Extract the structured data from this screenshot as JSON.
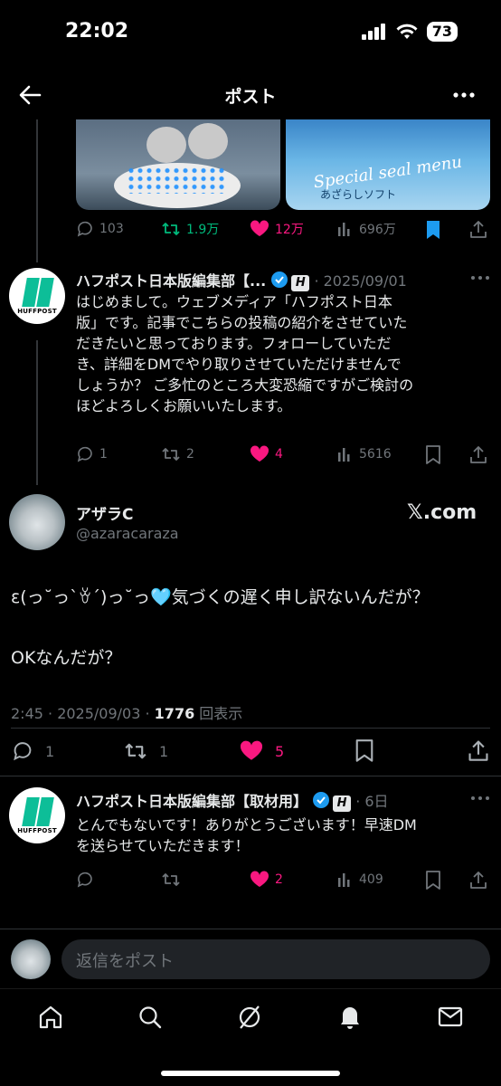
{
  "status_bar": {
    "time": "22:02",
    "battery": "73"
  },
  "header": {
    "title": "ポスト"
  },
  "images": {
    "special_text": "Special seal menu",
    "soft_text": "あざらしソフト"
  },
  "top_tweet_actions": {
    "replies": "103",
    "reposts": "1.9万",
    "likes": "12万",
    "views": "696万"
  },
  "reply1": {
    "name": "ハフポスト日本版編集部【...",
    "date": "· 2025/09/01",
    "avatar_text": "HUFFPOST",
    "badge": "H",
    "lines": [
      "はじめまして。ウェブメディア「ハフポスト日本",
      "版」です。記事でこちらの投稿の紹介をさせていた",
      "だきたいと思っております。フォローしていただ",
      "き、詳細をDMでやり取りさせていただけませんで",
      "しょうか？ ご多忙のところ大変恐縮ですがご検討の",
      "ほどよろしくお願いいたします。"
    ],
    "actions": {
      "replies": "1",
      "reposts": "2",
      "likes": "4",
      "views": "5616"
    }
  },
  "main_tweet": {
    "name": "アザラC",
    "handle": "@azaracaraza",
    "source": "𝕏.com",
    "line1": "ε(っ˘っ`ꈊ´)っ˘っ🩵気づくの遅く申し訳ないんだが？",
    "line2": "OKなんだが？",
    "time_date": "2:45 · 2025/09/03 · ",
    "views_count": "1776",
    "views_label": " 回表示",
    "actions": {
      "replies": "1",
      "reposts": "1",
      "likes": "5"
    }
  },
  "reply2": {
    "name": "ハフポスト日本版編集部【取材用】",
    "date": "· 6日",
    "avatar_text": "HUFFPOST",
    "badge": "H",
    "lines": [
      "とんでもないです！ありがとうございます！早速DM",
      "を送らせていただきます！"
    ],
    "actions": {
      "replies": "",
      "reposts": "",
      "likes": "2",
      "views": "409"
    }
  },
  "reply_bar": {
    "placeholder": "返信をポスト"
  },
  "tabs": [
    "home-icon",
    "search-icon",
    "grok-icon",
    "notifications-icon",
    "messages-icon"
  ],
  "colors": {
    "like": "#f91880",
    "repost": "#00ba7c",
    "verified": "#1d9bf0",
    "bookmark": "#1d9bf0"
  }
}
